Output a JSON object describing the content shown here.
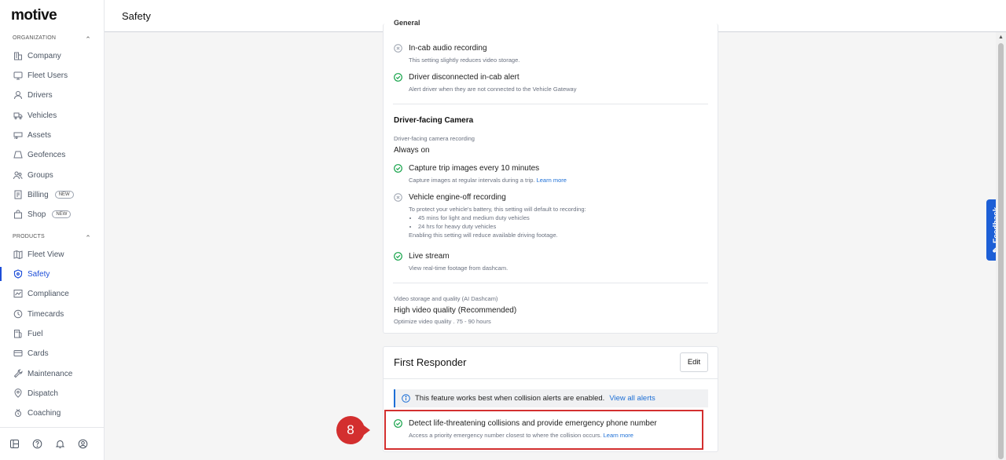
{
  "app": {
    "logo": "motive",
    "page_title": "Safety"
  },
  "sidebar": {
    "organization_heading": "ORGANIZATION",
    "products_heading": "PRODUCTS",
    "org_items": [
      {
        "label": "Company",
        "icon": "building-icon"
      },
      {
        "label": "Fleet Users",
        "icon": "monitor-icon"
      },
      {
        "label": "Drivers",
        "icon": "user-icon"
      },
      {
        "label": "Vehicles",
        "icon": "truck-icon"
      },
      {
        "label": "Assets",
        "icon": "trailer-icon"
      },
      {
        "label": "Geofences",
        "icon": "geofence-icon"
      },
      {
        "label": "Groups",
        "icon": "group-icon"
      },
      {
        "label": "Billing",
        "icon": "receipt-icon",
        "badge": "NEW"
      },
      {
        "label": "Shop",
        "icon": "bag-icon",
        "badge": "NEW"
      }
    ],
    "product_items": [
      {
        "label": "Fleet View",
        "icon": "map-icon"
      },
      {
        "label": "Safety",
        "icon": "shield-icon",
        "active": true
      },
      {
        "label": "Compliance",
        "icon": "chart-icon"
      },
      {
        "label": "Timecards",
        "icon": "clock-icon"
      },
      {
        "label": "Fuel",
        "icon": "fuel-icon"
      },
      {
        "label": "Cards",
        "icon": "card-icon"
      },
      {
        "label": "Maintenance",
        "icon": "wrench-icon"
      },
      {
        "label": "Dispatch",
        "icon": "pin-icon"
      },
      {
        "label": "Coaching",
        "icon": "coaching-icon"
      }
    ]
  },
  "feedback": {
    "label": "Feedback"
  },
  "settings_card": {
    "partial_heading": "General",
    "general": [
      {
        "title": "In-cab audio recording",
        "status": "disabled",
        "desc": "This setting slightly reduces video storage."
      },
      {
        "title": "Driver disconnected in-cab alert",
        "status": "enabled",
        "desc": "Alert driver when they are not connected to the Vehicle Gateway"
      }
    ],
    "driver_camera": {
      "title": "Driver-facing Camera",
      "recording_label": "Driver-facing camera recording",
      "recording_value": "Always on",
      "capture": {
        "title": "Capture trip images every 10 minutes",
        "desc": "Capture images at regular intervals during a trip.",
        "link": "Learn more"
      },
      "engine_off": {
        "title": "Vehicle engine-off recording",
        "desc": "To protect your vehicle's battery, this setting will default to recording:",
        "bullets": [
          "45 mins for light and medium duty vehicles",
          "24 hrs for heavy duty vehicles"
        ],
        "note": "Enabling this setting will reduce available driving footage."
      },
      "live_stream": {
        "title": "Live stream",
        "desc": "View real-time footage from dashcam."
      }
    },
    "video_quality": {
      "label": "Video storage and quality (AI Dashcam)",
      "value": "High video quality (Recommended)",
      "desc": "Optimize video quality . 75 - 90 hours"
    }
  },
  "first_responder": {
    "title": "First Responder",
    "edit_label": "Edit",
    "banner_text": "This feature works best when collision alerts are enabled.",
    "banner_link": "View all alerts",
    "setting_title": "Detect life-threatening collisions and provide emergency phone number",
    "setting_desc": "Access a priority emergency number closest to where the collision occurs.",
    "setting_link": "Learn more"
  },
  "annotation": {
    "step_number": "8",
    "color": "#d32f2f"
  },
  "colors": {
    "accent": "#1d6fd6",
    "enabled": "#16a34a",
    "disabled": "#9ca3af"
  }
}
